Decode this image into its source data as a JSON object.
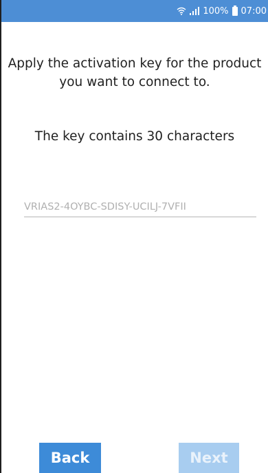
{
  "status_bar": {
    "battery_percent": "100%",
    "time": "07:00",
    "icons": [
      "wifi-icon",
      "signal-icon",
      "battery-icon"
    ],
    "background_color": "#4d8ed5"
  },
  "main": {
    "instruction": "Apply the activation key for the product you want to connect to.",
    "key_length_note": "The key contains 30 characters",
    "key_input": {
      "value": "",
      "placeholder": "VRIAS2-4OYBC-SDISY-UCILJ-7VFII"
    }
  },
  "footer": {
    "back_label": "Back",
    "next_label": "Next",
    "back_color": "#3d8bd8",
    "next_color": "#a8cdf0",
    "next_enabled": false
  }
}
